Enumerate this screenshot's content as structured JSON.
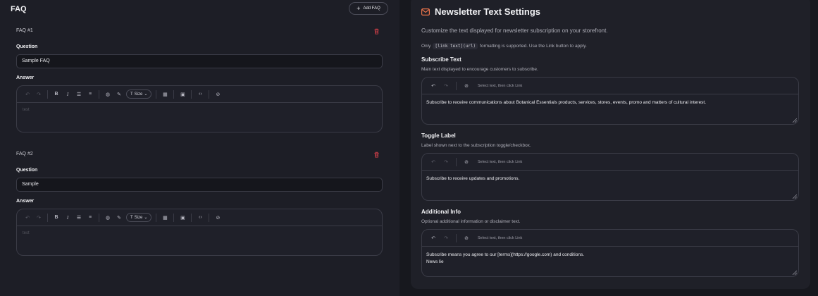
{
  "faq": {
    "title": "FAQ",
    "add_label": "Add FAQ",
    "items": [
      {
        "number": "FAQ #1",
        "question_label": "Question",
        "question_value": "Sample FAQ",
        "answer_label": "Answer",
        "answer_value": "test"
      },
      {
        "number": "FAQ #2",
        "question_label": "Question",
        "question_value": "Sample",
        "answer_label": "Answer",
        "answer_value": "test"
      }
    ],
    "toolbar": {
      "size_label": "Size"
    }
  },
  "newsletter": {
    "title": "Newsletter Text Settings",
    "description": "Customize the text displayed for newsletter subscription on your storefront.",
    "note_prefix": "Only",
    "note_code": "[link text](url)",
    "note_suffix": "formatting is supported. Use the Link button to apply.",
    "link_hint": "Select text, then click Link",
    "sections": [
      {
        "label": "Subscribe Text",
        "sub": "Main text displayed to encourage customers to subscribe.",
        "value_lines": [
          "Subscribe to receive communications about Botanical Essentials products, services, stores, events, promo and matters of cultural interest."
        ]
      },
      {
        "label": "Toggle Label",
        "sub": "Label shown next to the subscription toggle/checkbox.",
        "value_lines": [
          "Subscribe to receive updates and promotions."
        ]
      },
      {
        "label": "Additional Info",
        "sub": "Optional additional information or disclaimer text.",
        "value_lines": [
          "Subscribe means you agree to our [terms](https://google.com) and conditions.",
          "News lie"
        ]
      }
    ]
  },
  "colors": {
    "accent": "#e8734a",
    "danger": "#d9404a",
    "bg": "#1d1e26"
  }
}
